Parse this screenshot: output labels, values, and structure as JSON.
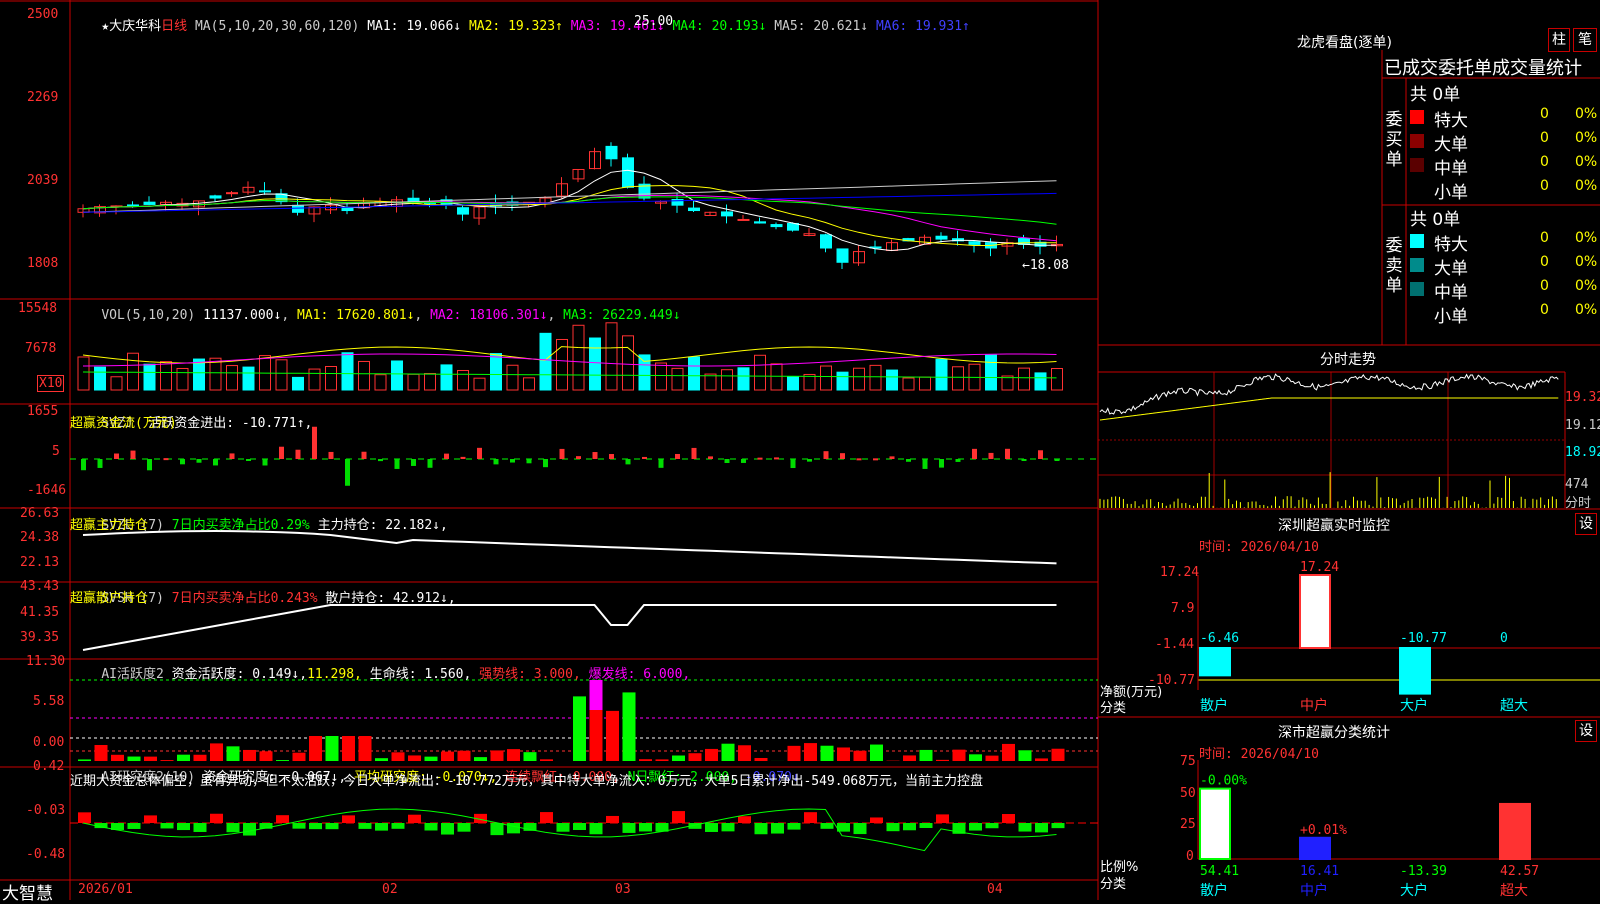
{
  "colors": {
    "up": "#ff3232",
    "down": "#00ffff",
    "grid": "#c80000",
    "bg": "#000000",
    "ma1": "#ffffff",
    "ma2": "#ffff00",
    "ma3": "#ff00ff",
    "ma4": "#00ff00",
    "ma5": "#cccccc",
    "ma6": "#0000ff"
  },
  "header": {
    "title": "★大庆华科",
    "period": "日线",
    "ma_label": "MA(5,10,20,30,60,120)",
    "ma1": "MA1: 19.066↓",
    "ma2": "MA2: 19.323↑",
    "ma3": "MA3: 19.461↓",
    "ma4": "MA4: 20.193↓",
    "ma5": "MA5: 20.621↓",
    "ma6": "MA6: 19.931↑",
    "high_mark": "25.00",
    "low_mark": "←18.08"
  },
  "price_axis": [
    "2500",
    "2269",
    "2039",
    "1808"
  ],
  "vol_panel": {
    "label": "VOL(5,10,20)",
    "value": "11137.000↓",
    "ma1": "MA1: 17620.801↓",
    "ma2": "MA2: 18106.301↓",
    "ma3": "MA3: 26229.449↓",
    "axis": [
      "15548",
      "7678"
    ],
    "unit": "X10"
  },
  "svzj_panel": {
    "label": "SVZJ",
    "text": "活跃资金进出: -10.771↑,",
    "subtitle": "超赢资金流(万元)",
    "axis": [
      "1655",
      "5",
      "-1646"
    ]
  },
  "svzl_panel": {
    "label": "SVZL (7)",
    "text1": "7日内买卖净占比0.29%",
    "text2": "主力持仓: 22.182↓,",
    "subtitle": "超赢主力持仓",
    "axis": [
      "26.63",
      "24.38",
      "22.13"
    ]
  },
  "svsh_panel": {
    "label": "SVSH (7)",
    "text1": "7日内买卖净占比0.243%",
    "text2": "散户持仓: 42.912↓,",
    "subtitle": "超赢散户持仓",
    "axis": [
      "43.43",
      "41.35",
      "39.35"
    ]
  },
  "ai_panel": {
    "label": "AI活跃度2",
    "t1": "资金活跃度: 0.149↓,",
    "t2": "11.298,",
    "t3": "生命线: 1.560,",
    "t4": "强势线: 3.000,",
    "t5": "爆发线: 6.000,",
    "axis": [
      "11.30",
      "5.58",
      "0.00"
    ]
  },
  "research_panel": {
    "label": "AI研究度2(10)",
    "t1": "资金研究度: -0.067↓,",
    "t2": "平均研究度: -0.070↓,",
    "t3": "连续飘红: 0.000,",
    "t4": "N日飘红: 2.000,",
    "t5": "-0.070↓",
    "summary": "近期大资金总体偏空，虽有异动，但不太活跃，今日大单净流出：-10.772万元，其中特大单净流入：0万元，大单5日累计净出-549.068万元，当前主力控盘",
    "axis": [
      "0.42",
      "-0.03",
      "-0.48"
    ]
  },
  "date_axis": {
    "brand": "大智慧",
    "dates": [
      "2026/01",
      "02",
      "03",
      "04"
    ]
  },
  "dragon": {
    "title": "龙虎看盘(逐单)",
    "btn1": "柱",
    "btn2": "笔",
    "subtitle": "已成交委托单成交量统计",
    "buy_label": "委买单",
    "sell_label": "委卖单",
    "buy_total": "共 0单",
    "sell_total": "共 0单",
    "buy_rows": [
      {
        "name": "特大",
        "count": "0",
        "pct": "0%",
        "color": "#ff0000"
      },
      {
        "name": "大单",
        "count": "0",
        "pct": "0%",
        "color": "#8b0000"
      },
      {
        "name": "中单",
        "count": "0",
        "pct": "0%",
        "color": "#5a0000"
      },
      {
        "name": "小单",
        "count": "0",
        "pct": "0%",
        "color": ""
      }
    ],
    "sell_rows": [
      {
        "name": "特大",
        "count": "0",
        "pct": "0%",
        "color": "#00ffff"
      },
      {
        "name": "大单",
        "count": "0",
        "pct": "0%",
        "color": "#008b8b"
      },
      {
        "name": "中单",
        "count": "0",
        "pct": "0%",
        "color": "#007070"
      },
      {
        "name": "小单",
        "count": "0",
        "pct": "0%",
        "color": ""
      }
    ]
  },
  "intraday": {
    "title": "分时走势",
    "axis": [
      "19.32",
      "19.12",
      "18.92"
    ],
    "vol_axis": [
      "474",
      "分时"
    ]
  },
  "monitor": {
    "title": "深圳超赢实时监控",
    "btn": "设",
    "time": "时间: 2026/04/10",
    "axis": [
      "17.24",
      "7.9",
      "-1.44",
      "-10.77"
    ],
    "ylabel": "净额(万元)",
    "xlabel": "分类",
    "categories": [
      "散户",
      "中户",
      "大户",
      "超大"
    ],
    "values": [
      "-6.46",
      "17.24",
      "-10.77",
      "0"
    ]
  },
  "classify": {
    "title": "深市超赢分类统计",
    "btn": "设",
    "time": "时间: 2026/04/10",
    "axis": [
      "75",
      "50",
      "25",
      "0"
    ],
    "ylabel": "比例%",
    "xlabel": "分类",
    "categories": [
      "散户",
      "中户",
      "大户",
      "超大"
    ],
    "top_labels": [
      "-0.00%",
      "+0.01%",
      "",
      ""
    ],
    "bottom_values": [
      "54.41",
      "16.41",
      "-13.39",
      "42.57"
    ]
  },
  "chart_data": {
    "type": "candlestick",
    "title": "大庆华科 日线",
    "x": [
      "2026/01",
      "02",
      "03",
      "04"
    ],
    "ylim": [
      1808,
      2500
    ],
    "high": 25.0,
    "low": 18.08,
    "ma_latest": {
      "MA1": 19.066,
      "MA2": 19.323,
      "MA3": 19.461,
      "MA4": 20.193,
      "MA5": 20.621,
      "MA6": 19.931
    },
    "vol_latest": 11137.0,
    "vol_ma": {
      "MA1": 17620.801,
      "MA2": 18106.301,
      "MA3": 26229.449
    },
    "svzj_latest": -10.771,
    "svzl_latest": 22.182,
    "svsh_latest": 42.912,
    "ai_active": {
      "资金活跃度": 0.149,
      "生命线": 1.56,
      "强势线": 3.0,
      "爆发线": 6.0
    },
    "ai_research": {
      "资金研究度": -0.067,
      "平均研究度": -0.07,
      "连续飘红": 0.0,
      "N日飘红": 2.0
    }
  }
}
